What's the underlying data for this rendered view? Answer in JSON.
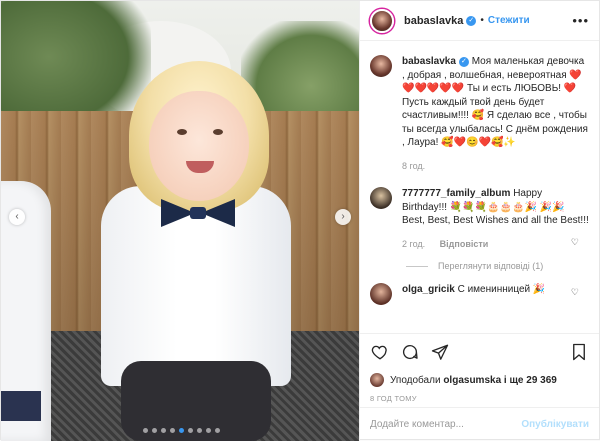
{
  "header": {
    "username": "babaslavka",
    "separator": "•",
    "follow_label": "Стежити",
    "more_glyph": "•••"
  },
  "caption": {
    "username": "babaslavka",
    "text": "Моя маленькая девочка , добрая , волшебная, невероятная ❤️❤️❤️❤️❤️❤️ Ты и есть ЛЮБОВЬ! ❤️ Пусть каждый твой день будет счастливым!!!! 🥰 Я сделаю все , чтобы ты всегда улыбалась! С днём рождения , Лаура! 🥰❤️😊❤️🥰✨",
    "time": "8 год."
  },
  "comments": [
    {
      "username": "7777777_family_album",
      "text": "Happy Birthday!!! 💐💐💐🎂🎂🎂🎉 🎉🎉 Best, Best, Best Wishes and all the Best!!!",
      "time": "2 год.",
      "reply_label": "Відповісти",
      "view_replies": "Переглянути відповіді (1)"
    },
    {
      "username": "olga_gricik",
      "text": "С именинницей 🎉"
    }
  ],
  "likes": {
    "prefix": "Уподобали",
    "user": "olgasumska",
    "suffix": "і ще 29 369"
  },
  "timestamp": "8 ГОД ТОМУ",
  "add_comment": {
    "placeholder": "Додайте коментар...",
    "post_label": "Опублікувати"
  },
  "carousel": {
    "slide_count": 9,
    "active_index": 4
  },
  "icons": {
    "like": "heart-icon",
    "comment": "comment-icon",
    "share": "share-icon",
    "save": "bookmark-icon",
    "verified": "verified-badge-icon"
  },
  "colors": {
    "accent": "#3897f0",
    "post_disabled": "#b2dffc",
    "muted": "#999999"
  }
}
